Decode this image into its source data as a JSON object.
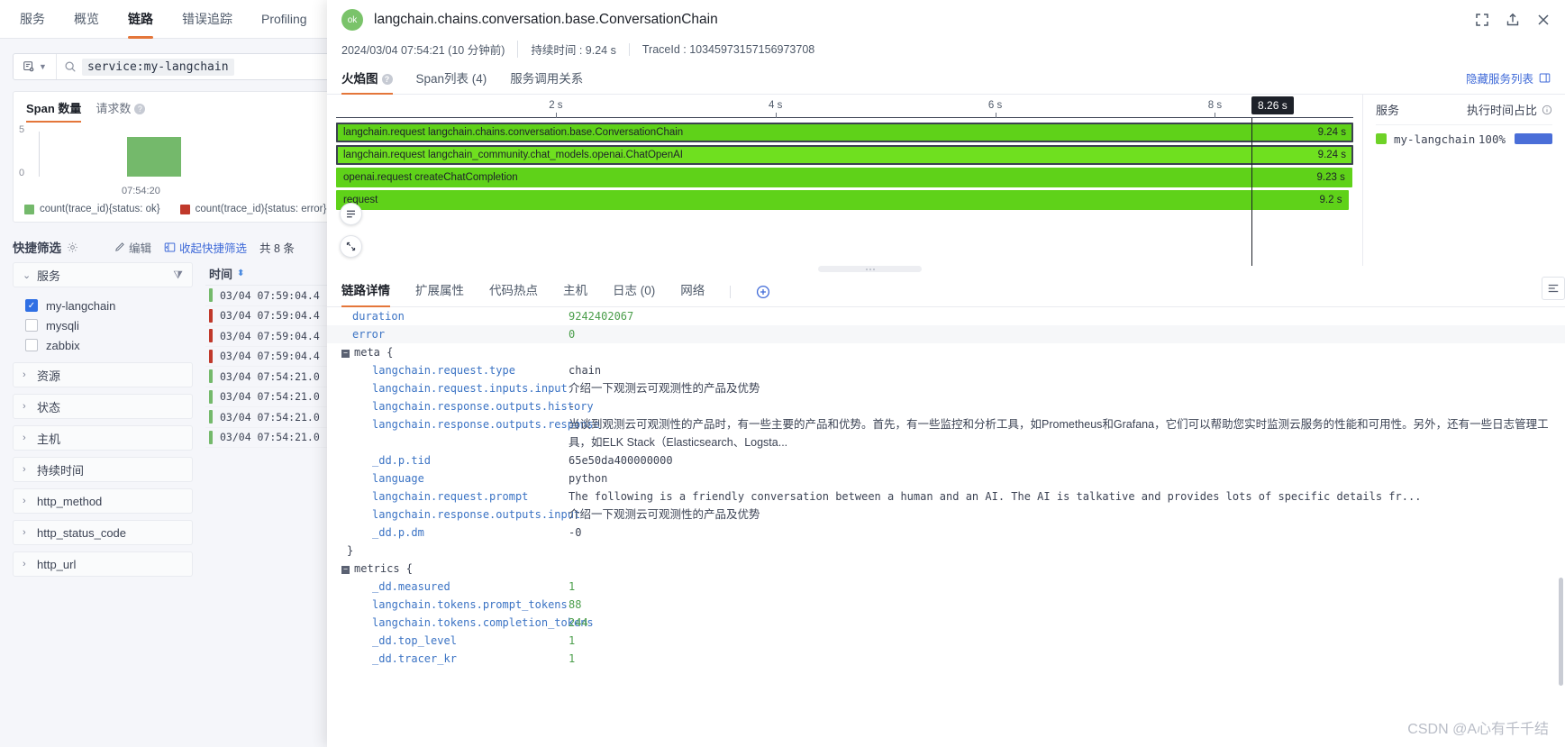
{
  "topnav": {
    "items": [
      {
        "label": "服务",
        "active": false
      },
      {
        "label": "概览",
        "active": false
      },
      {
        "label": "链路",
        "active": true
      },
      {
        "label": "错误追踪",
        "active": false
      },
      {
        "label": "Profiling",
        "active": false
      }
    ]
  },
  "search": {
    "query": "service:my-langchain"
  },
  "chart_card": {
    "tabs": [
      {
        "label": "Span 数量",
        "active": true
      },
      {
        "label": "请求数",
        "active": false
      }
    ]
  },
  "chart_data": {
    "type": "bar",
    "title": "Span 数量",
    "categories": [
      "07:54:20"
    ],
    "series": [
      {
        "name": "count(trace_id){status: ok}",
        "values": [
          4
        ],
        "color": "#74b96b"
      },
      {
        "name": "count(trace_id){status: error}",
        "values": [
          0
        ],
        "color": "#c0392b"
      }
    ],
    "xlabel": "",
    "ylabel": "",
    "ylim": [
      0,
      5
    ],
    "yticks": [
      "0",
      "5"
    ],
    "grid": false,
    "legend_position": "bottom"
  },
  "quick_filter": {
    "title": "快捷筛选",
    "edit_label": "编辑",
    "collapse_label": "收起快捷筛选",
    "count_label": "共 8 条",
    "groups": [
      {
        "label": "服务",
        "expanded": true,
        "options": [
          {
            "label": "my-langchain",
            "checked": true
          },
          {
            "label": "mysqli",
            "checked": false
          },
          {
            "label": "zabbix",
            "checked": false
          }
        ]
      },
      {
        "label": "资源",
        "expanded": false,
        "options": []
      },
      {
        "label": "状态",
        "expanded": false,
        "options": []
      },
      {
        "label": "主机",
        "expanded": false,
        "options": []
      },
      {
        "label": "持续时间",
        "expanded": false,
        "options": []
      },
      {
        "label": "http_method",
        "expanded": false,
        "options": []
      },
      {
        "label": "http_status_code",
        "expanded": false,
        "options": []
      },
      {
        "label": "http_url",
        "expanded": false,
        "options": []
      }
    ]
  },
  "trace_list": {
    "column_header": "时间",
    "rows": [
      {
        "time": "03/04 07:59:04.4",
        "status": "ok"
      },
      {
        "time": "03/04 07:59:04.4",
        "status": "error"
      },
      {
        "time": "03/04 07:59:04.4",
        "status": "error"
      },
      {
        "time": "03/04 07:59:04.4",
        "status": "error"
      },
      {
        "time": "03/04 07:54:21.0",
        "status": "ok"
      },
      {
        "time": "03/04 07:54:21.0",
        "status": "ok"
      },
      {
        "time": "03/04 07:54:21.0",
        "status": "ok"
      },
      {
        "time": "03/04 07:54:21.0",
        "status": "ok"
      }
    ]
  },
  "drawer": {
    "status_badge": "ok",
    "title": "langchain.chains.conversation.base.ConversationChain",
    "meta": {
      "timestamp": "2024/03/04 07:54:21 (10 分钟前)",
      "duration": "持续时间 : 9.24 s",
      "trace_id": "TraceId : 10345973157156973708"
    },
    "tabs": [
      {
        "label": "火焰图",
        "active": true,
        "has_help": true
      },
      {
        "label": "Span列表 (4)",
        "active": false,
        "has_help": false
      },
      {
        "label": "服务调用关系",
        "active": false,
        "has_help": false
      }
    ],
    "hide_service_list": "隐藏服务列表"
  },
  "flame": {
    "ticks": [
      {
        "label": "2 s",
        "pct": 21.6
      },
      {
        "label": "4 s",
        "pct": 43.2
      },
      {
        "label": "6 s",
        "pct": 64.8
      },
      {
        "label": "8 s",
        "pct": 86.4
      }
    ],
    "tooltip": "8.26 s",
    "tooltip_pct": 89.3,
    "bars": [
      {
        "label": "langchain.request langchain.chains.conversation.base.ConversationChain",
        "duration": "9.24 s",
        "color": "#5fd219",
        "width_pct": 100,
        "selected": true
      },
      {
        "label": "langchain.request langchain_community.chat_models.openai.ChatOpenAI",
        "duration": "9.24 s",
        "color": "#6fe01f",
        "width_pct": 100,
        "selected": true
      },
      {
        "label": "openai.request createChatCompletion",
        "duration": "9.23 s",
        "color": "#5fd219",
        "width_pct": 99.9,
        "selected": false
      },
      {
        "label": "request",
        "duration": "9.2 s",
        "color": "#5fd219",
        "width_pct": 99.6,
        "selected": false
      }
    ]
  },
  "service_panel": {
    "col_service": "服务",
    "col_ratio": "执行时间占比",
    "rows": [
      {
        "name": "my-langchain",
        "pct": "100%",
        "color": "#6ed227",
        "bar_color": "#4a6ed8"
      }
    ]
  },
  "detail_tabs": [
    {
      "label": "链路详情",
      "active": true
    },
    {
      "label": "扩展属性",
      "active": false
    },
    {
      "label": "代码热点",
      "active": false
    },
    {
      "label": "主机",
      "active": false
    },
    {
      "label": "日志 (0)",
      "active": false
    },
    {
      "label": "网络",
      "active": false
    }
  ],
  "json_detail": {
    "rows": [
      {
        "kind": "kv",
        "indent": 1,
        "key": "duration",
        "value": "9242402067",
        "vtype": "num",
        "alt": false
      },
      {
        "kind": "kv",
        "indent": 1,
        "key": "error",
        "value": "0",
        "vtype": "num",
        "alt": true
      },
      {
        "kind": "open",
        "indent": 0,
        "key": "meta {",
        "value": "",
        "vtype": "none",
        "alt": false
      },
      {
        "kind": "kv",
        "indent": 2,
        "key": "langchain.request.type",
        "value": "chain",
        "vtype": "mono",
        "alt": false
      },
      {
        "kind": "kv",
        "indent": 2,
        "key": "langchain.request.inputs.input",
        "value": "介绍一下观测云可观测性的产品及优势",
        "vtype": "cn",
        "alt": false
      },
      {
        "kind": "kv",
        "indent": 2,
        "key": "langchain.response.outputs.history",
        "value": "-",
        "vtype": "mono",
        "alt": false
      },
      {
        "kind": "kv",
        "indent": 2,
        "key": "langchain.response.outputs.response",
        "value": "当谈到观测云可观测性的产品时，有一些主要的产品和优势。首先，有一些监控和分析工具，如Prometheus和Grafana，它们可以帮助您实时监测云服务的性能和可用性。另外，还有一些日志管理工具，如ELK Stack（Elasticsearch、Logsta...",
        "vtype": "cn",
        "alt": false
      },
      {
        "kind": "kv",
        "indent": 2,
        "key": "_dd.p.tid",
        "value": "65e50da400000000",
        "vtype": "mono",
        "alt": false
      },
      {
        "kind": "kv",
        "indent": 2,
        "key": "language",
        "value": "python",
        "vtype": "mono",
        "alt": false
      },
      {
        "kind": "kv",
        "indent": 2,
        "key": "langchain.request.prompt",
        "value": "The following is a friendly conversation between a human and an AI. The AI is talkative and provides lots of specific details fr...",
        "vtype": "mono",
        "alt": false
      },
      {
        "kind": "kv",
        "indent": 2,
        "key": "langchain.response.outputs.input",
        "value": "介绍一下观测云可观测性的产品及优势",
        "vtype": "cn",
        "alt": false
      },
      {
        "kind": "kv",
        "indent": 2,
        "key": "_dd.p.dm",
        "value": "-0",
        "vtype": "mono",
        "alt": false
      },
      {
        "kind": "close",
        "indent": 1,
        "key": "}",
        "value": "",
        "vtype": "none",
        "alt": false
      },
      {
        "kind": "open",
        "indent": 0,
        "key": "metrics {",
        "value": "",
        "vtype": "none",
        "alt": false
      },
      {
        "kind": "kv",
        "indent": 2,
        "key": "_dd.measured",
        "value": "1",
        "vtype": "num",
        "alt": false
      },
      {
        "kind": "kv",
        "indent": 2,
        "key": "langchain.tokens.prompt_tokens",
        "value": "88",
        "vtype": "num",
        "alt": false
      },
      {
        "kind": "kv",
        "indent": 2,
        "key": "langchain.tokens.completion_tokens",
        "value": "244",
        "vtype": "num",
        "alt": false
      },
      {
        "kind": "kv",
        "indent": 2,
        "key": "_dd.top_level",
        "value": "1",
        "vtype": "num",
        "alt": false
      },
      {
        "kind": "kv",
        "indent": 2,
        "key": "_dd.tracer_kr",
        "value": "1",
        "vtype": "num",
        "alt": false
      }
    ]
  },
  "watermark": "CSDN @A心有千千结"
}
